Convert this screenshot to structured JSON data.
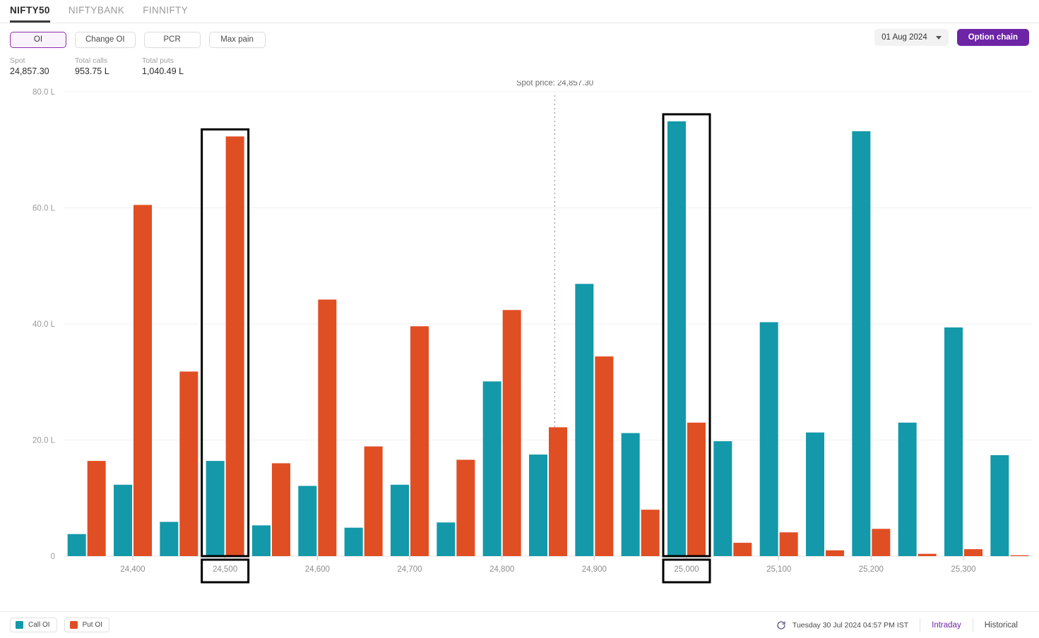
{
  "index_tabs": [
    {
      "label": "NIFTY50",
      "active": true
    },
    {
      "label": "NIFTYBANK",
      "active": false
    },
    {
      "label": "FINNIFTY",
      "active": false
    }
  ],
  "view_buttons": [
    {
      "label": "OI",
      "active": true
    },
    {
      "label": "Change OI",
      "active": false
    },
    {
      "label": "PCR",
      "active": false
    },
    {
      "label": "Max pain",
      "active": false
    }
  ],
  "date_selector": {
    "value": "01 Aug 2024",
    "icon": "chevron-down-icon"
  },
  "option_chain_button": {
    "label": "Option chain"
  },
  "stats": [
    {
      "label": "Spot",
      "value": "24,857.30"
    },
    {
      "label": "Total calls",
      "value": "953.75 L"
    },
    {
      "label": "Total puts",
      "value": "1,040.49 L"
    }
  ],
  "spot_annotation": {
    "text": "Spot price: 24,857.30",
    "strike": 24857.3
  },
  "legend": [
    {
      "label": "Call OI",
      "color": "#1399a9"
    },
    {
      "label": "Put OI",
      "color": "#e04e23"
    }
  ],
  "footer": {
    "refresh_icon": "refresh-icon",
    "timestamp": "Tuesday 30 Jul 2024 04:57 PM IST",
    "tabs": [
      {
        "label": "Intraday",
        "active": true
      },
      {
        "label": "Historical",
        "active": false
      }
    ]
  },
  "colors": {
    "call": "#1399a9",
    "put": "#e04e23",
    "accent": "#6d25a6",
    "grid": "#f0f0f0",
    "highlight_box": "#000000"
  },
  "chart_data": {
    "type": "bar",
    "title": "",
    "xlabel": "",
    "ylabel": "",
    "ylim": [
      0,
      80
    ],
    "y_unit": "L",
    "y_ticks": [
      0,
      20,
      40,
      60,
      80
    ],
    "y_tick_labels": [
      "0",
      "20.0 L",
      "40.0 L",
      "60.0 L",
      "80.0 L"
    ],
    "grid": true,
    "legend_position": "bottom-left",
    "axis_tick_labels": [
      "24,400",
      "24,500",
      "24,600",
      "24,700",
      "24,800",
      "24,900",
      "25,000",
      "25,100",
      "25,200",
      "25,300"
    ],
    "highlighted_strikes": [
      24500,
      25000
    ],
    "categories": [
      24350,
      24400,
      24450,
      24500,
      24550,
      24600,
      24650,
      24700,
      24750,
      24800,
      24850,
      24900,
      24950,
      25000,
      25050,
      25100,
      25150,
      25200,
      25250,
      25300,
      25350
    ],
    "series": [
      {
        "name": "Call OI",
        "color": "#1399a9",
        "values": [
          3.8,
          12.3,
          5.9,
          16.4,
          5.3,
          12.1,
          4.9,
          12.3,
          5.8,
          30.1,
          17.5,
          46.9,
          21.2,
          74.9,
          19.8,
          40.3,
          21.3,
          73.2,
          23.0,
          39.4,
          17.4
        ]
      },
      {
        "name": "Put OI",
        "color": "#e04e23",
        "values": [
          16.4,
          60.5,
          31.8,
          72.3,
          16.0,
          44.2,
          18.9,
          39.6,
          16.6,
          42.4,
          22.2,
          34.4,
          8.0,
          23.0,
          2.3,
          4.1,
          1.0,
          4.7,
          0.4,
          1.2,
          0.15
        ]
      }
    ]
  }
}
